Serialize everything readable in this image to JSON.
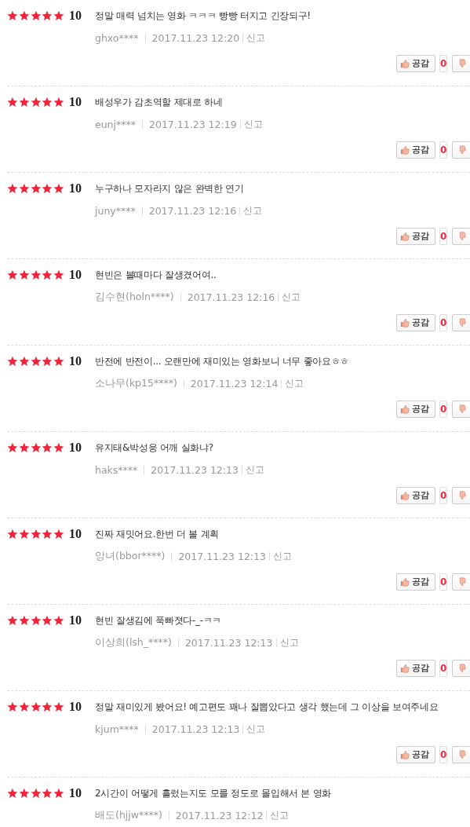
{
  "reviews": [
    {
      "stars": 5,
      "score": "10",
      "text": "정말 매력 넘치는 영화 ㅋㅋㅋ 빵빵 터지고 긴장되구!",
      "user": "ghxo****",
      "date": "2017.11.23 12:20",
      "report": "신고",
      "like_label": "공감",
      "like_count": "0"
    },
    {
      "stars": 5,
      "score": "10",
      "text": "배성우가 감초역할 제대로 하네",
      "user": "eunj****",
      "date": "2017.11.23 12:19",
      "report": "신고",
      "like_label": "공감",
      "like_count": "0"
    },
    {
      "stars": 5,
      "score": "10",
      "text": "누구하나 모자라지 않은 완벽한 연기",
      "user": "juny****",
      "date": "2017.11.23 12:16",
      "report": "신고",
      "like_label": "공감",
      "like_count": "0"
    },
    {
      "stars": 5,
      "score": "10",
      "text": "현빈은 볼때마다 잘생겼어여..",
      "user": "김수현(holn****)",
      "date": "2017.11.23 12:16",
      "report": "신고",
      "like_label": "공감",
      "like_count": "0"
    },
    {
      "stars": 5,
      "score": "10",
      "text": "반전에 반전이... 오랜만에 재미있는 영화보니 너무 좋아요ㅎㅎ",
      "user": "소나무(kp15****)",
      "date": "2017.11.23 12:14",
      "report": "신고",
      "like_label": "공감",
      "like_count": "0"
    },
    {
      "stars": 5,
      "score": "10",
      "text": "유지태&박성웅 어깨 실화냐?",
      "user": "haks****",
      "date": "2017.11.23 12:13",
      "report": "신고",
      "like_label": "공감",
      "like_count": "0"
    },
    {
      "stars": 5,
      "score": "10",
      "text": "진짜 재밋어요.한번 더 볼 계획",
      "user": "앙녀(bbor****)",
      "date": "2017.11.23 12:13",
      "report": "신고",
      "like_label": "공감",
      "like_count": "0"
    },
    {
      "stars": 5,
      "score": "10",
      "text": "현빈 잘생김에 푹빠졋다-_-ㅋㅋ",
      "user": "이상희(lsh_****)",
      "date": "2017.11.23 12:13",
      "report": "신고",
      "like_label": "공감",
      "like_count": "0"
    },
    {
      "stars": 5,
      "score": "10",
      "text": "정말 재미있게 봤어요! 예고편도 꽤나 잘뽑았다고 생각 했는데 그 이상을 보여주네요",
      "user": "kjum****",
      "date": "2017.11.23 12:13",
      "report": "신고",
      "like_label": "공감",
      "like_count": "0"
    },
    {
      "stars": 5,
      "score": "10",
      "text": "2시간이 어떻게 흘렀는지도 모를 정도로 몰입해서 본 영화",
      "user": "배도(hjjw****)",
      "date": "2017.11.23 12:12",
      "report": "신고"
    }
  ]
}
